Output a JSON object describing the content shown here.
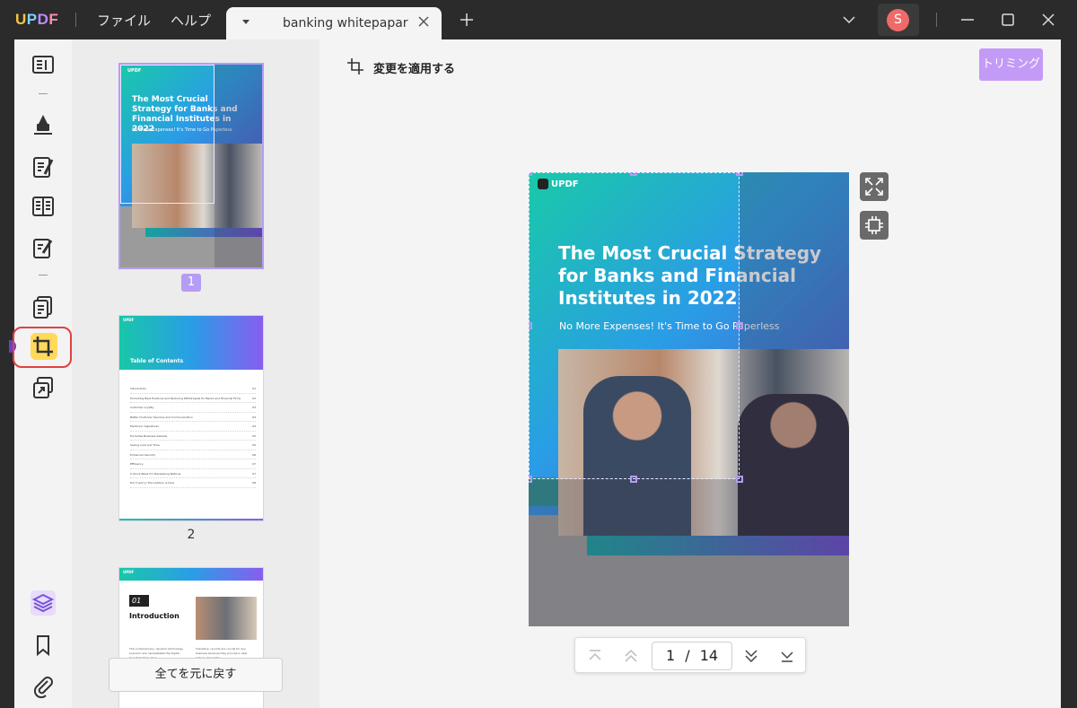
{
  "app": {
    "logo_letters": [
      "U",
      "P",
      "D",
      "F"
    ],
    "menu": {
      "file": "ファイル",
      "help": "ヘルプ"
    },
    "tab": {
      "title": "banking whitepapar"
    },
    "user": {
      "initial": "S"
    },
    "colors": {
      "accent": "#b59cf5",
      "active_tool": "#ffd95a",
      "highlight": "#e04141"
    }
  },
  "toolbar": {
    "items": [
      {
        "name": "reader-icon"
      },
      {
        "name": "highlighter-icon"
      },
      {
        "name": "edit-text-icon"
      },
      {
        "name": "page-layout-icon"
      },
      {
        "name": "sign-icon"
      },
      {
        "name": "organize-pages-icon"
      },
      {
        "name": "crop-icon",
        "active": true
      },
      {
        "name": "convert-icon"
      },
      {
        "name": "layers-icon"
      },
      {
        "name": "bookmark-icon"
      },
      {
        "name": "attachment-icon"
      }
    ]
  },
  "thumbnails": {
    "pages": [
      {
        "number": "1",
        "active": true
      },
      {
        "number": "2"
      },
      {
        "number": ""
      }
    ],
    "thumb1": {
      "logo": "UPDF",
      "title": "The Most Crucial Strategy for Banks and Financial Institutes in 2022",
      "subtitle": "No More Expenses! It's Time to Go Paperless"
    },
    "thumb2": {
      "logo": "UPDF",
      "heading": "Table of Contents",
      "toc": [
        {
          "label": "Introduction",
          "page": "01"
        },
        {
          "label": "Promoting Best Practices and Reducing Withdrawals for Banks and Financial Firms",
          "page": "02"
        },
        {
          "label": "Customer Loyalty",
          "page": "03"
        },
        {
          "label": "Better Customer Services and Communication",
          "page": "04"
        },
        {
          "label": "Electronic Signatures",
          "page": "04"
        },
        {
          "label": "Promotes Business Globally",
          "page": "05"
        },
        {
          "label": "Saving Cost and Time",
          "page": "05"
        },
        {
          "label": "Enhanced Security",
          "page": "06"
        },
        {
          "label": "Efficiency",
          "page": "07"
        },
        {
          "label": "A Quick Basis For Developing Nations",
          "page": "07"
        },
        {
          "label": "Don't worry! The solution is here",
          "page": "08"
        }
      ]
    },
    "thumb3": {
      "logo": "UPDF",
      "chapter_number": "01",
      "chapter_title": "Introduction",
      "body_left": "The contemporary, dynamic technology scenario now necessitates the digital transformation of an",
      "body_right": "Therefore, records are crucial for any business because they provide a clear picture of how the"
    },
    "reset_button": "全てを元に戻す"
  },
  "main": {
    "apply_label": "変更を適用する",
    "trim_button": "トリミング",
    "page": {
      "logo": "UPDF",
      "title": "The Most Crucial Strategy for Banks and Financial Institutes in 2022",
      "subtitle": "No More Expenses! It's Time to Go Paperless"
    },
    "pager": {
      "current": "1",
      "separator": "/",
      "total": "14"
    }
  }
}
